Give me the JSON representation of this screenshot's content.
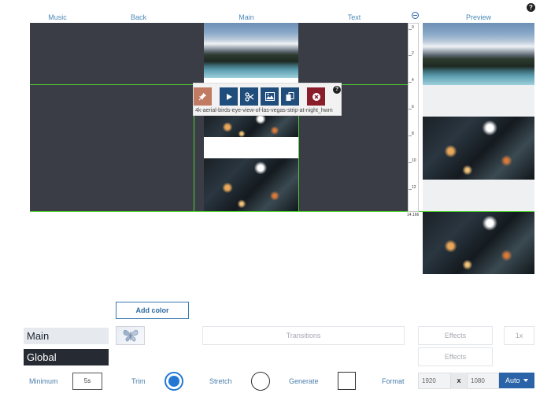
{
  "columns": {
    "music": "Music",
    "back": "Back",
    "main": "Main",
    "text": "Text",
    "preview": "Preview"
  },
  "ruler": {
    "ticks": [
      "0",
      "2",
      "4",
      "6",
      "8",
      "10",
      "12"
    ],
    "end_label": "14.166"
  },
  "clip_toolbar": {
    "filename": "4k-aerial-birds-eye-view-of-las-vegas-strip-at-night_hwm",
    "icons": [
      "pin-icon",
      "play-icon",
      "scissors-icon",
      "image-icon",
      "copy-icon",
      "delete-icon"
    ]
  },
  "buttons": {
    "add_color": "Add color",
    "auto": "Auto"
  },
  "tabs": {
    "main": "Main",
    "global": "Global"
  },
  "panels": {
    "transitions": "Transitions",
    "effects_1": "Effects",
    "effects_2": "Effects",
    "speed": "1x"
  },
  "settings": {
    "minimum_label": "Minimum",
    "minimum_value": "5s",
    "trim_label": "Trim",
    "stretch_label": "Stretch",
    "generate_label": "Generate",
    "format_label": "Format",
    "width": "1920",
    "separator": "x",
    "height": "1080"
  },
  "colors": {
    "timeline_bg": "#3a3d45",
    "selection_green": "#4fcf33",
    "toolbar_blue": "#1f4d7c",
    "delete_red": "#8a1d2a",
    "accent_blue": "#2b63a8"
  }
}
